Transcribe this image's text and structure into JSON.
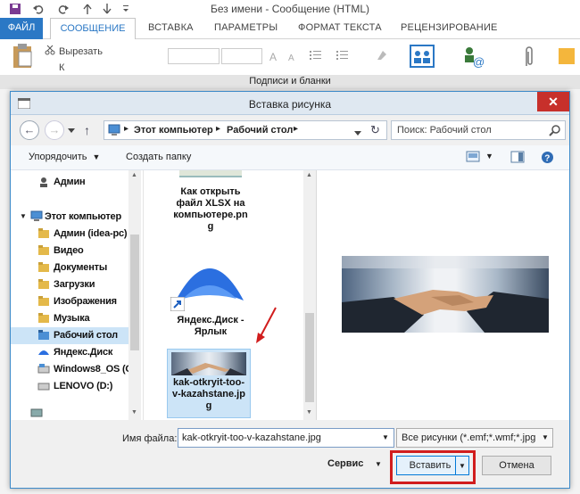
{
  "app": {
    "window_title": "Без имени - Сообщение (HTML)",
    "quick_access": [
      "save-icon",
      "undo-icon",
      "redo-icon",
      "up-icon",
      "down-icon",
      "dropdown-icon"
    ]
  },
  "ribbon": {
    "tabs": [
      "ФАЙЛ",
      "СООБЩЕНИЕ",
      "ВСТАВКА",
      "ПАРАМЕТРЫ",
      "ФОРМАТ ТЕКСТА",
      "РЕЦЕНЗИРОВАНИЕ"
    ],
    "cut_label": "Вырезать",
    "copy_partial": "К"
  },
  "signature_bar": "Подписи и бланки",
  "dialog": {
    "title": "Вставка рисунка",
    "breadcrumb": [
      "Этот компьютер",
      "Рабочий стол"
    ],
    "search_placeholder": "Поиск: Рабочий стол",
    "organize_label": "Упорядочить",
    "new_folder_label": "Создать папку",
    "nav_items": [
      {
        "label": "Админ",
        "icon": "user-icon"
      },
      {
        "label": "Этот компьютер",
        "icon": "computer-icon"
      },
      {
        "label": "Админ (idea-pc)",
        "icon": "folder-icon"
      },
      {
        "label": "Видео",
        "icon": "folder-icon"
      },
      {
        "label": "Документы",
        "icon": "folder-icon"
      },
      {
        "label": "Загрузки",
        "icon": "folder-icon"
      },
      {
        "label": "Изображения",
        "icon": "folder-icon"
      },
      {
        "label": "Музыка",
        "icon": "folder-icon"
      },
      {
        "label": "Рабочий стол",
        "icon": "folder-icon",
        "selected": true
      },
      {
        "label": "Яндекс.Диск",
        "icon": "folder-icon"
      },
      {
        "label": "Windows8_OS (C",
        "icon": "drive-icon"
      },
      {
        "label": "LENOVO (D:)",
        "icon": "drive-icon"
      }
    ],
    "files": [
      {
        "name_lines": [
          "Как открыть",
          "файл XLSX на",
          "компьютере.pn",
          "g"
        ]
      },
      {
        "name_lines": [
          "Яндекс.Диск -",
          "Ярлык"
        ]
      },
      {
        "name_lines": [
          "kak-otkryit-too-",
          "v-kazahstane.jp",
          "g"
        ],
        "selected": true
      }
    ],
    "filename_label": "Имя файла:",
    "filename_value": "kak-otkryit-too-v-kazahstane.jpg",
    "filter_value": "Все рисунки (*.emf;*.wmf;*.jpg",
    "tools_label": "Сервис",
    "insert_label": "Вставить",
    "cancel_label": "Отмена"
  },
  "colors": {
    "accent": "#2b78c5",
    "highlight_border": "#d11d1d",
    "selection": "#cce4f7"
  }
}
